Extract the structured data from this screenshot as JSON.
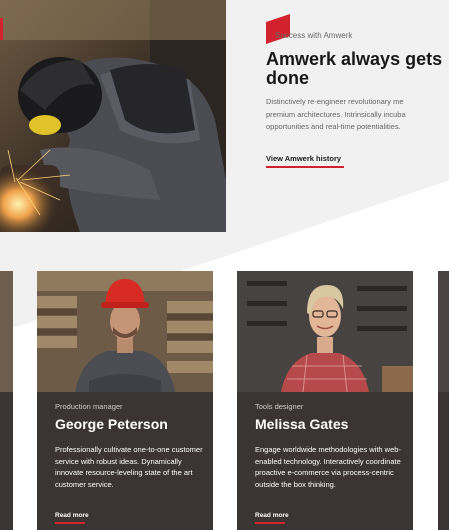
{
  "hero": {
    "eyebrow": "Success with Amwerk",
    "title_line1": "Amwerk always gets",
    "title_line2": "done",
    "body_lines": [
      "Distinctively re-engineer revolutionary me",
      "premium architectures. Intrinsically incuba",
      "opportunities and real-time potentialities."
    ],
    "link_label": "View Amwerk history"
  },
  "team": [
    {
      "role": "Production manager",
      "name": "George Peterson",
      "description": "Professionally cultivate one-to-one customer service with robust ideas. Dynamically innovate resource-leveling state of the art customer service.",
      "link_label": "Read more"
    },
    {
      "role": "Tools designer",
      "name": "Melissa Gates",
      "description": "Engage worldwide methodologies with web-enabled technology. Interactively coordinate proactive e-commerce via process-centric outside the box thinking.",
      "link_label": "Read more"
    }
  ],
  "colors": {
    "accent": "#d2222d",
    "card_bg": "#3a3532",
    "page_bg": "#f1f1f1"
  }
}
